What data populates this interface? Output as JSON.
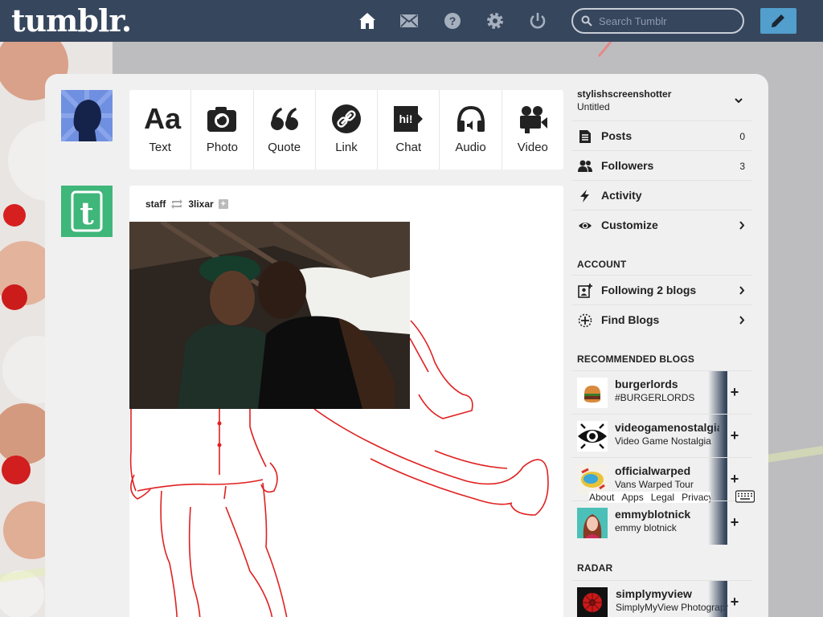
{
  "header": {
    "logo": "tumblr.",
    "search_placeholder": "Search Tumblr",
    "nav": [
      "home-icon",
      "mail-icon",
      "help-icon",
      "gear-icon",
      "power-icon"
    ],
    "compose_icon": "pencil-icon"
  },
  "post_types": [
    {
      "label": "Text",
      "icon": "text-aa-icon"
    },
    {
      "label": "Photo",
      "icon": "camera-icon"
    },
    {
      "label": "Quote",
      "icon": "quote-icon"
    },
    {
      "label": "Link",
      "icon": "link-icon"
    },
    {
      "label": "Chat",
      "icon": "chat-icon"
    },
    {
      "label": "Audio",
      "icon": "headphones-icon"
    },
    {
      "label": "Video",
      "icon": "video-camera-icon"
    }
  ],
  "post": {
    "author": "staff",
    "reblogged_from": "3lixar"
  },
  "sidebar": {
    "blog_name": "stylishscreenshotter",
    "blog_title": "Untitled",
    "rows": [
      {
        "label": "Posts",
        "count": "0",
        "icon": "posts-icon"
      },
      {
        "label": "Followers",
        "count": "3",
        "icon": "followers-icon"
      },
      {
        "label": "Activity",
        "icon": "lightning-icon"
      },
      {
        "label": "Customize",
        "icon": "eye-icon"
      }
    ],
    "account_heading": "ACCOUNT",
    "account_rows": [
      {
        "label": "Following 2 blogs",
        "icon": "following-icon"
      },
      {
        "label": "Find Blogs",
        "icon": "find-blogs-icon"
      }
    ],
    "recommended_heading": "RECOMMENDED BLOGS",
    "recommended": [
      {
        "name": "burgerlords",
        "desc": "#BURGERLORDS"
      },
      {
        "name": "videogamenostalgia",
        "desc": "Video Game Nostalgia"
      },
      {
        "name": "officialwarped",
        "desc": "Vans Warped Tour"
      },
      {
        "name": "emmyblotnick",
        "desc": "emmy blotnick"
      }
    ],
    "radar_heading": "RADAR",
    "radar": {
      "name": "simplymyview",
      "desc": "SimplyMyView Photography"
    }
  },
  "footer": {
    "about": "About",
    "apps": "Apps",
    "legal": "Legal",
    "privacy": "Privacy"
  },
  "colors": {
    "header_bg": "#36465d",
    "compose_bg": "#529ecc",
    "tumblr_green": "#3fb67a",
    "drawing_red": "#e02020"
  }
}
